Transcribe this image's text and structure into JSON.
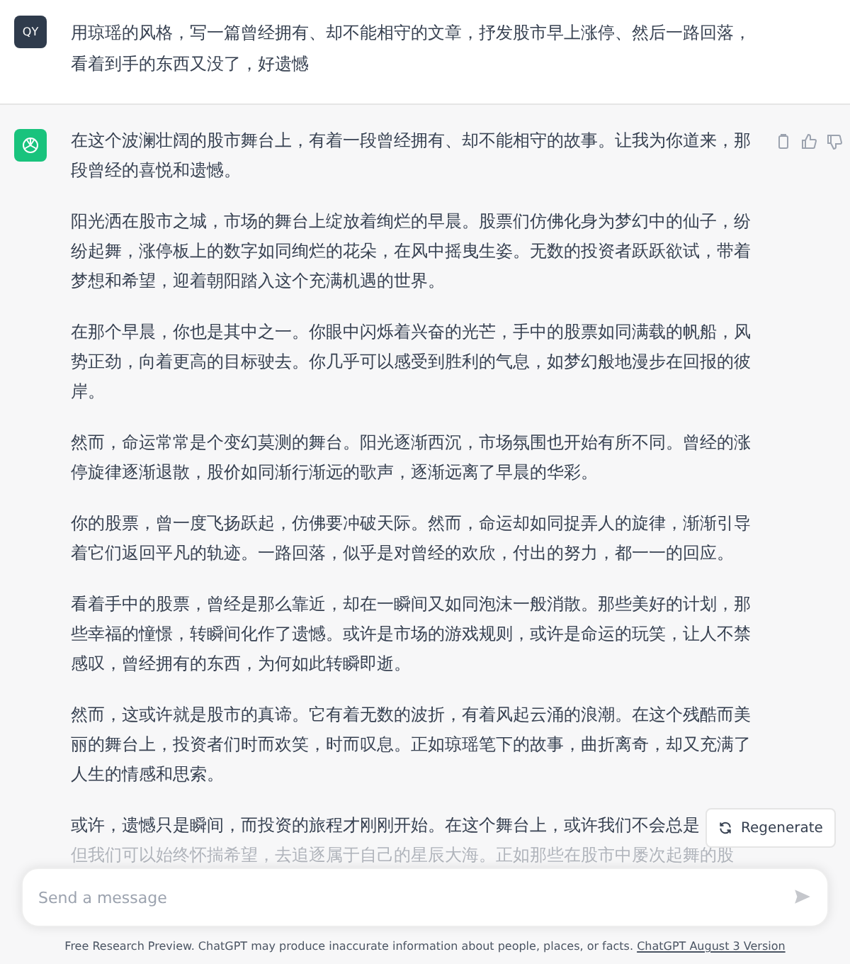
{
  "user_message": {
    "avatar": "QY",
    "text": "用琼瑶的风格，写一篇曾经拥有、却不能相守的文章，抒发股市早上涨停、然后一路回落，看着到手的东西又没了，好遗憾"
  },
  "assistant_message": {
    "paragraphs": [
      "在这个波澜壮阔的股市舞台上，有着一段曾经拥有、却不能相守的故事。让我为你道来，那段曾经的喜悦和遗憾。",
      "阳光洒在股市之城，市场的舞台上绽放着绚烂的早晨。股票们仿佛化身为梦幻中的仙子，纷纷起舞，涨停板上的数字如同绚烂的花朵，在风中摇曳生姿。无数的投资者跃跃欲试，带着梦想和希望，迎着朝阳踏入这个充满机遇的世界。",
      "在那个早晨，你也是其中之一。你眼中闪烁着兴奋的光芒，手中的股票如同满载的帆船，风势正劲，向着更高的目标驶去。你几乎可以感受到胜利的气息，如梦幻般地漫步在回报的彼岸。",
      "然而，命运常常是个变幻莫测的舞台。阳光逐渐西沉，市场氛围也开始有所不同。曾经的涨停旋律逐渐退散，股价如同渐行渐远的歌声，逐渐远离了早晨的华彩。",
      "你的股票，曾一度飞扬跃起，仿佛要冲破天际。然而，命运却如同捉弄人的旋律，渐渐引导着它们返回平凡的轨迹。一路回落，似乎是对曾经的欢欣，付出的努力，都一一的回应。",
      "看着手中的股票，曾经是那么靠近，却在一瞬间又如同泡沫一般消散。那些美好的计划，那些幸福的憧憬，转瞬间化作了遗憾。或许是市场的游戏规则，或许是命运的玩笑，让人不禁感叹，曾经拥有的东西，为何如此转瞬即逝。",
      "然而，这或许就是股市的真谛。它有着无数的波折，有着风起云涌的浪潮。在这个残酷而美丽的舞台上，投资者们时而欢笑，时而叹息。正如琼瑶笔下的故事，曲折离奇，却又充满了人生的情感和思索。"
    ],
    "last_lines": [
      "或许，遗憾只是瞬间，而投资的旅程才刚刚开始。在这个舞台上，或许我们不会总是",
      "但我们可以始终怀揣希望，去追逐属于自己的星辰大海。正如那些在股市中屡次起舞的股"
    ]
  },
  "regenerate_button": "Regenerate",
  "composer": {
    "placeholder": "Send a message"
  },
  "footer": {
    "text": "Free Research Preview. ChatGPT may produce inaccurate information about people, places, or facts.",
    "link": "ChatGPT August 3 Version"
  }
}
